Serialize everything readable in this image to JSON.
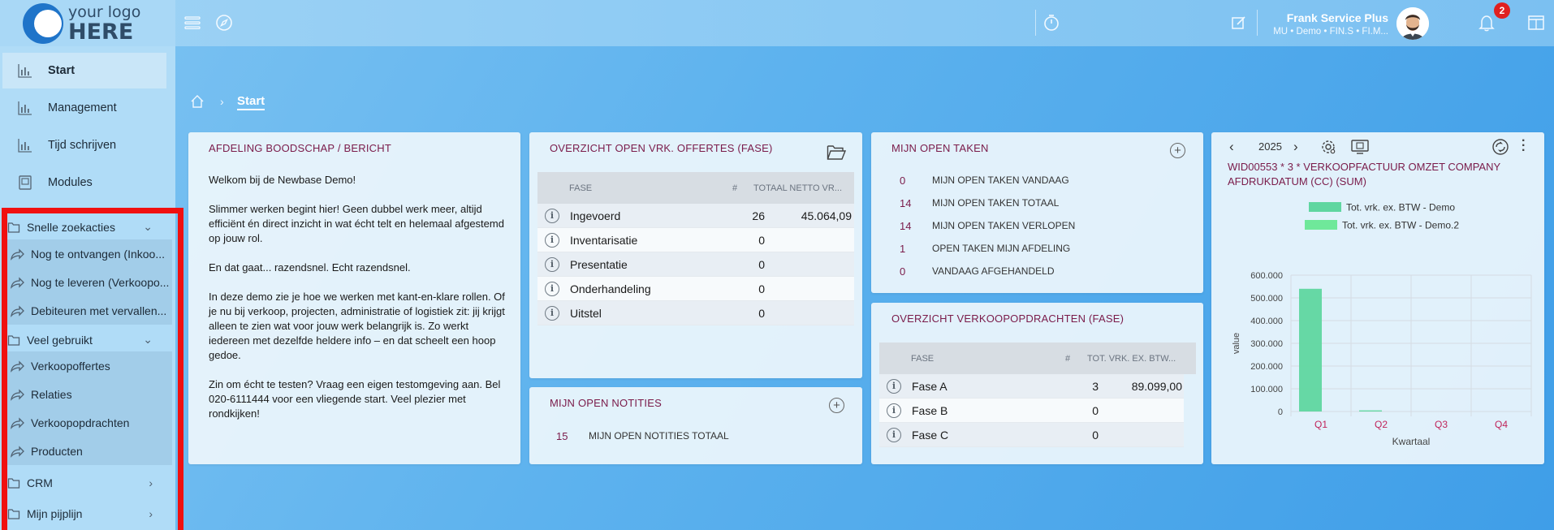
{
  "logo": {
    "line1": "your logo",
    "line2": "HERE"
  },
  "header": {
    "user_name": "Frank Service Plus",
    "user_sub": "MU • Demo • FIN.S • FI.M...",
    "notification_count": "2"
  },
  "sidebar": {
    "nav": [
      {
        "label": "Start",
        "icon": "chart-icon",
        "active": true
      },
      {
        "label": "Management",
        "icon": "chart-icon"
      },
      {
        "label": "Tijd schrijven",
        "icon": "chart-icon"
      },
      {
        "label": "Modules",
        "icon": "modules-icon"
      }
    ],
    "groups": {
      "snelle": {
        "label": "Snelle zoekacties",
        "expanded": true,
        "items": [
          "Nog te ontvangen (Inkoo...",
          "Nog te leveren (Verkoopo...",
          "Debiteuren met vervallen..."
        ]
      },
      "veel": {
        "label": "Veel gebruikt",
        "expanded": true,
        "items": [
          "Verkoopoffertes",
          "Relaties",
          "Verkoopopdrachten",
          "Producten"
        ]
      },
      "crm": {
        "label": "CRM",
        "expanded": false
      },
      "pijplijn": {
        "label": "Mijn pijplijn",
        "expanded": false
      }
    }
  },
  "breadcrumb": {
    "current": "Start"
  },
  "message_card": {
    "title": "AFDELING BOODSCHAP / BERICHT",
    "p1": "Welkom bij de Newbase Demo!",
    "p2": "Slimmer werken begint hier! Geen dubbel werk meer, altijd efficiënt én direct inzicht in wat écht telt en helemaal afgestemd op jouw rol.",
    "p3": "En dat gaat... razendsnel. Echt razendsnel.",
    "p4": "In deze demo zie je hoe we werken met kant-en-klare rollen. Of je nu bij verkoop, projecten, administratie of logistiek zit: jij krijgt alleen te zien wat voor jouw werk belangrijk is. Zo werkt iedereen met dezelfde heldere info – en dat scheelt een hoop gedoe.",
    "p5": "Zin om écht te testen? Vraag een eigen testomgeving aan. Bel 020-6111444 voor een vliegende start. Veel plezier met rondkijken!"
  },
  "offertes_card": {
    "title": "OVERZICHT OPEN VRK. OFFERTES (FASE)",
    "headers": {
      "fase": "FASE",
      "count": "#",
      "total": "TOTAAL NETTO VR..."
    },
    "rows": [
      {
        "fase": "Ingevoerd",
        "count": "26",
        "total": "45.064,09"
      },
      {
        "fase": "Inventarisatie",
        "count": "0",
        "total": ""
      },
      {
        "fase": "Presentatie",
        "count": "0",
        "total": ""
      },
      {
        "fase": "Onderhandeling",
        "count": "0",
        "total": ""
      },
      {
        "fase": "Uitstel",
        "count": "0",
        "total": ""
      }
    ]
  },
  "notities_card": {
    "title": "MIJN OPEN NOTITIES",
    "rows": [
      {
        "num": "15",
        "label": "MIJN OPEN NOTITIES TOTAAL"
      }
    ]
  },
  "taken_card": {
    "title": "MIJN OPEN TAKEN",
    "rows": [
      {
        "num": "0",
        "label": "MIJN OPEN TAKEN VANDAAG"
      },
      {
        "num": "14",
        "label": "MIJN OPEN TAKEN TOTAAL"
      },
      {
        "num": "14",
        "label": "MIJN OPEN TAKEN VERLOPEN"
      },
      {
        "num": "1",
        "label": "OPEN TAKEN MIJN AFDELING"
      },
      {
        "num": "0",
        "label": "VANDAAG AFGEHANDELD"
      }
    ]
  },
  "opdrachten_card": {
    "title": "OVERZICHT VERKOOPOPDRACHTEN (FASE)",
    "headers": {
      "fase": "FASE",
      "count": "#",
      "total": "TOT. VRK. EX. BTW..."
    },
    "rows": [
      {
        "fase": "Fase A",
        "count": "3",
        "total": "89.099,00"
      },
      {
        "fase": "Fase B",
        "count": "0",
        "total": ""
      },
      {
        "fase": "Fase C",
        "count": "0",
        "total": ""
      }
    ]
  },
  "chart_card": {
    "year": "2025",
    "title": "WID00553 * 3 * VERKOOPFACTUUR OMZET COMPANY AFDRUKDATUM (CC) (SUM)"
  },
  "chart_data": {
    "type": "bar",
    "categories": [
      "Q1",
      "Q2",
      "Q3",
      "Q4"
    ],
    "series": [
      {
        "name": "Tot. vrk. ex. BTW - Demo",
        "values": [
          540000,
          5000,
          0,
          0
        ],
        "color": "#5fd6a0"
      },
      {
        "name": "Tot. vrk. ex. BTW - Demo.2",
        "values": [
          0,
          0,
          0,
          0
        ],
        "color": "#6fe89a"
      }
    ],
    "xlabel": "Kwartaal",
    "ylabel": "value",
    "ylim": [
      0,
      600000
    ],
    "yticks": [
      "0",
      "100.000",
      "200.000",
      "300.000",
      "400.000",
      "500.000",
      "600.000"
    ],
    "grid": true,
    "legend": "top"
  }
}
